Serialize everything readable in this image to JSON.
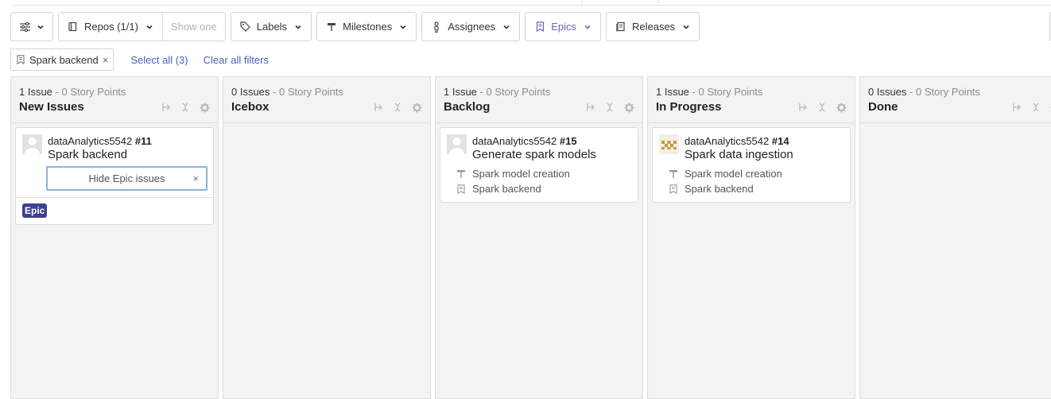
{
  "toolbar": {
    "settings_icon": "sliders-icon",
    "repos_label": "Repos (1/1)",
    "show_one_label": "Show one",
    "labels_label": "Labels",
    "milestones_label": "Milestones",
    "assignees_label": "Assignees",
    "epics_label": "Epics",
    "releases_label": "Releases",
    "active_color": "#6e62b8"
  },
  "filters": {
    "chip_label": "Spark backend",
    "select_all": "Select all (3)",
    "clear_all": "Clear all filters",
    "link_color": "#4a63b5"
  },
  "columns": [
    {
      "count": "1 Issue",
      "points": "- 0 Story Points",
      "title": "New Issues",
      "cards": [
        {
          "repo": "dataAnalytics5542",
          "number": "#11",
          "title": "Spark backend",
          "hide_epic_input": "Hide Epic issues",
          "badge": "Epic",
          "badge_color": "#3d3f8f"
        }
      ]
    },
    {
      "count": "0 Issues",
      "points": "- 0 Story Points",
      "title": "Icebox",
      "cards": []
    },
    {
      "count": "1 Issue",
      "points": "- 0 Story Points",
      "title": "Backlog",
      "cards": [
        {
          "repo": "dataAnalytics5542",
          "number": "#15",
          "title": "Generate spark models",
          "milestone": "Spark model creation",
          "epic": "Spark backend"
        }
      ]
    },
    {
      "count": "1 Issue",
      "points": "- 0 Story Points",
      "title": "In Progress",
      "cards": [
        {
          "repo": "dataAnalytics5542",
          "number": "#14",
          "title": "Spark data ingestion",
          "milestone": "Spark model creation",
          "epic": "Spark backend"
        }
      ]
    },
    {
      "count": "0 Issues",
      "points": "- 0 Story Points",
      "title": "Done",
      "cards": []
    }
  ]
}
